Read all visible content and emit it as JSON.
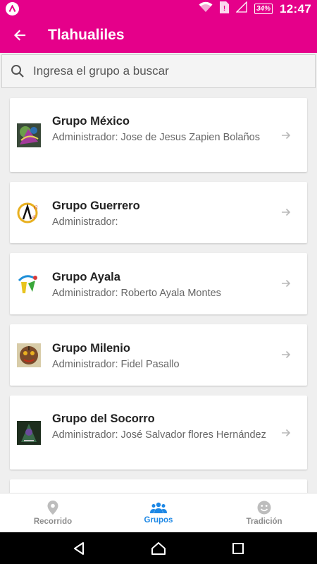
{
  "status_bar": {
    "time": "12:47",
    "battery": "34%"
  },
  "app_bar": {
    "title": "Tlahualiles"
  },
  "search": {
    "placeholder": "Ingresa el grupo a buscar"
  },
  "groups": [
    {
      "name": "Grupo México",
      "admin": "Administrador: Jose de Jesus Zapien Bolaños",
      "logo_icon": "grupo-mexico-logo-icon"
    },
    {
      "name": "Grupo Guerrero",
      "admin": "Administrador:",
      "logo_icon": "grupo-guerrero-logo-icon"
    },
    {
      "name": "Grupo Ayala",
      "admin": "Administrador: Roberto Ayala Montes",
      "logo_icon": "grupo-ayala-logo-icon"
    },
    {
      "name": "Grupo Milenio",
      "admin": "Administrador: Fidel Pasallo",
      "logo_icon": "grupo-milenio-logo-icon"
    },
    {
      "name": "Grupo del Socorro",
      "admin": "Administrador: José Salvador flores Hernández",
      "logo_icon": "grupo-del-socorro-logo-icon"
    }
  ],
  "bottom_nav": {
    "items": [
      {
        "label": "Recorrido",
        "icon": "location-pin-icon",
        "active": false
      },
      {
        "label": "Grupos",
        "icon": "groups-icon",
        "active": true
      },
      {
        "label": "Tradición",
        "icon": "smiley-icon",
        "active": false
      }
    ]
  },
  "colors": {
    "primary": "#e5008a",
    "active_nav": "#1e88e5",
    "inactive_nav": "#8d8d8d"
  }
}
